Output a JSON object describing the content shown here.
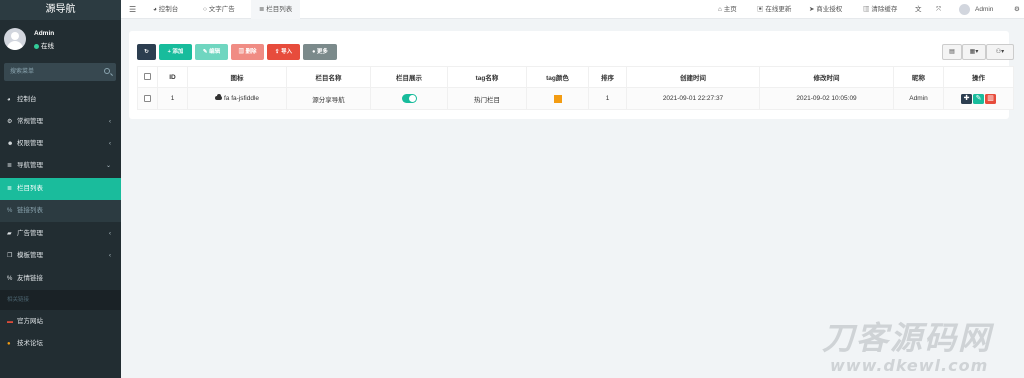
{
  "sidebar": {
    "logo": "源导航",
    "user_name": "Admin",
    "user_status": "在线",
    "search_placeholder": "搜索菜单",
    "items": [
      {
        "label": "控制台",
        "icon": "dashboard-icon",
        "glyph": "◕"
      },
      {
        "label": "常规管理",
        "icon": "cogs-icon",
        "glyph": "⚙",
        "chevron": "‹"
      },
      {
        "label": "权限管理",
        "icon": "group-icon",
        "glyph": "☻",
        "chevron": "‹"
      },
      {
        "label": "导航管理",
        "icon": "list-icon",
        "glyph": "≣",
        "chevron": "⌄"
      },
      {
        "label": "栏目列表",
        "icon": "list-icon",
        "glyph": "≣"
      },
      {
        "label": "链接列表",
        "icon": "link-icon",
        "glyph": "%"
      },
      {
        "label": "广告管理",
        "icon": "car-icon",
        "glyph": "▰",
        "chevron": "‹"
      },
      {
        "label": "模板管理",
        "icon": "clone-icon",
        "glyph": "❐",
        "chevron": "‹"
      },
      {
        "label": "友情链接",
        "icon": "link-icon",
        "glyph": "%"
      },
      {
        "label": "相关链接"
      },
      {
        "label": "官方网站",
        "icon": "official-site-icon",
        "glyph": "▬"
      },
      {
        "label": "技术论坛",
        "icon": "forum-icon",
        "glyph": "●"
      }
    ]
  },
  "topbar": {
    "menu_glyph": "☰",
    "tabs": [
      {
        "label": "控制台",
        "glyph": "◕"
      },
      {
        "label": "文字广告",
        "glyph": "○"
      },
      {
        "label": "栏目列表",
        "glyph": "≣"
      }
    ],
    "right": [
      {
        "label": "主页",
        "glyph": "⌂"
      },
      {
        "label": "在线更新",
        "glyph": "▣"
      },
      {
        "label": "商业授权",
        "glyph": "➤"
      },
      {
        "label": "清除缓存",
        "glyph": "▥"
      }
    ],
    "lang_glyph": "文",
    "fullscreen_glyph": "⤧",
    "admin_label": "Admin",
    "settings_glyph": "⚙"
  },
  "toolbar": {
    "refresh_glyph": "↻",
    "add": "添加",
    "add_glyph": "+",
    "edit": "编辑",
    "edit_glyph": "✎",
    "delete": "删除",
    "delete_glyph": "▥",
    "import": "导入",
    "import_glyph": "⇪",
    "more": "更多",
    "more_glyph": "●",
    "right_glyphs": [
      "▤",
      "▦▾",
      "⚇▾"
    ]
  },
  "table": {
    "headers": [
      "ID",
      "图标",
      "栏目名称",
      "栏目展示",
      "tag名称",
      "tag颜色",
      "排序",
      "创建时间",
      "修改时间",
      "昵称",
      "操作"
    ],
    "rows": [
      {
        "id": "1",
        "icon": "fa fa-jsfiddle",
        "name": "源分享导航",
        "tag": "热门栏目",
        "sort": "1",
        "created": "2021-09-01 22:27:37",
        "updated": "2021-09-02 10:05:09",
        "nickname": "Admin",
        "ops": [
          "✚",
          "✎",
          "▥"
        ]
      }
    ]
  },
  "watermark": {
    "line1": "刀客源码网",
    "line2": "www.dkewl.com"
  },
  "colors": {
    "sidebar": "#222d32",
    "accent": "#1abc9c",
    "add": "#18bc9c",
    "edit": "#48c9b0",
    "delete": "#f08080",
    "import": "#e74c3c",
    "more": "#7b8a8b",
    "dark": "#2c3e50",
    "tag": "#f39c12"
  }
}
